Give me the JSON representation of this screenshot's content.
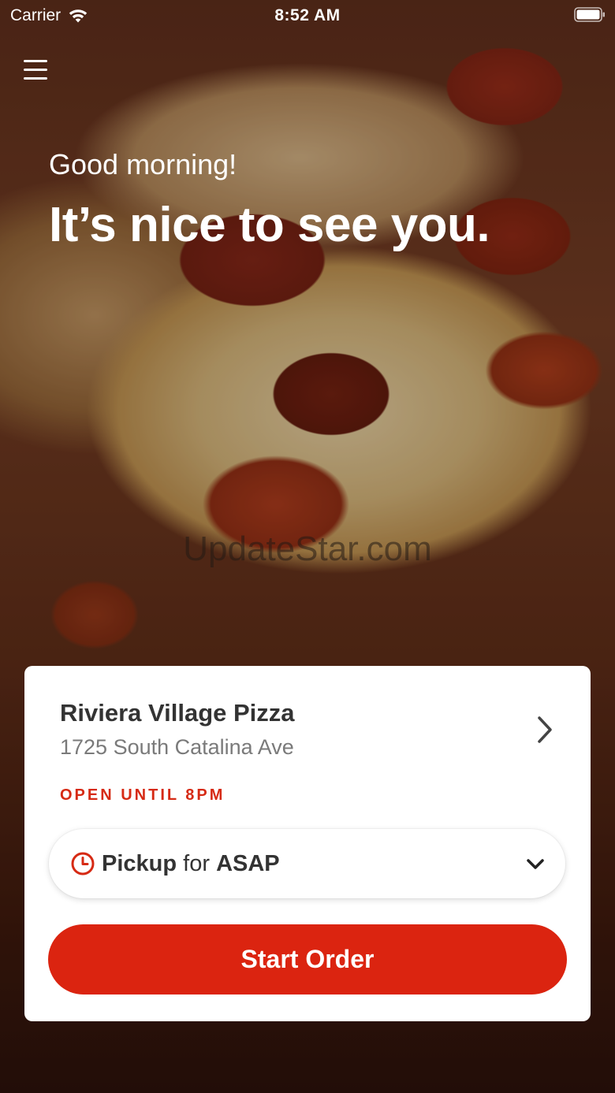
{
  "status_bar": {
    "carrier": "Carrier",
    "time": "8:52 AM"
  },
  "hero": {
    "greeting": "Good morning!",
    "headline": "It’s nice to see you.",
    "watermark": "UpdateStar.com"
  },
  "store": {
    "name": "Riviera Village Pizza",
    "address": "1725 South Catalina Ave",
    "hours_status": "OPEN UNTIL 8PM"
  },
  "order_time": {
    "mode": "Pickup",
    "connector": "for",
    "when": "ASAP"
  },
  "actions": {
    "start_order": "Start Order"
  },
  "colors": {
    "accent": "#db2410",
    "status_red": "#d62a14",
    "text_dark": "#333333",
    "text_muted": "#7a7a7a"
  },
  "icons": {
    "menu": "hamburger-menu-icon",
    "wifi": "wifi-icon",
    "battery": "battery-icon",
    "chevron": "chevron-right-icon",
    "clock": "clock-icon",
    "dropdown": "chevron-down-icon"
  }
}
